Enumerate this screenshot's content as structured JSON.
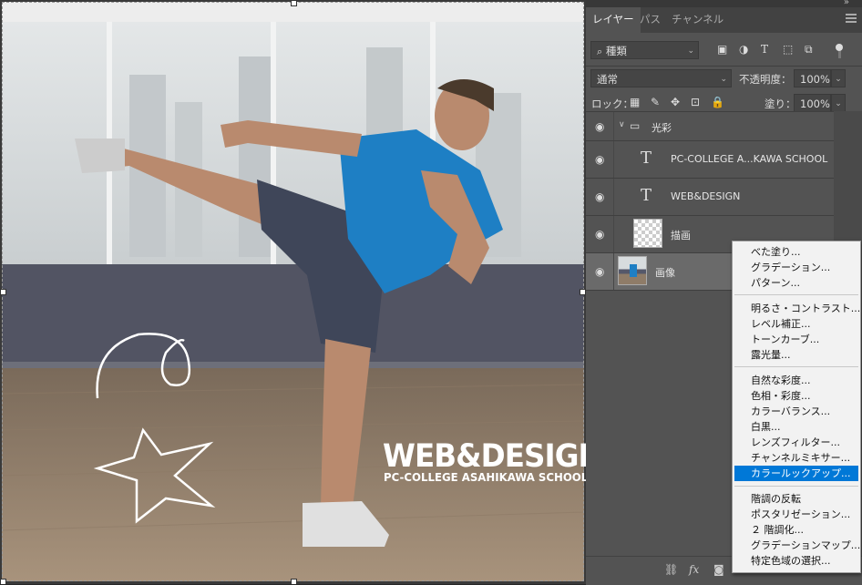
{
  "canvas": {
    "title_text": "WEB&DESIGN",
    "subtitle_text": "PC-COLLEGE ASAHIKAWA SCHOOL"
  },
  "panel": {
    "tabs": [
      {
        "label": "レイヤー",
        "active": true
      },
      {
        "label": "パス",
        "active": false
      },
      {
        "label": "チャンネル",
        "active": false
      }
    ],
    "filter_kind": "種類",
    "blend_mode": "通常",
    "opacity_label": "不透明度：",
    "opacity_value": "100%",
    "lock_label": "ロック：",
    "fill_label": "塗り：",
    "fill_value": "100%",
    "layers": [
      {
        "name": "光彩",
        "type": "group"
      },
      {
        "name": "PC-COLLEGE A...KAWA SCHOOL",
        "type": "text"
      },
      {
        "name": "WEB&DESIGN",
        "type": "text"
      },
      {
        "name": "描画",
        "type": "raster"
      },
      {
        "name": "画像",
        "type": "image",
        "selected": true
      }
    ]
  },
  "context_menu": {
    "groups": [
      [
        "べた塗り...",
        "グラデーション...",
        "パターン..."
      ],
      [
        "明るさ・コントラスト...",
        "レベル補正...",
        "トーンカーブ...",
        "露光量..."
      ],
      [
        "自然な彩度...",
        "色相・彩度...",
        "カラーバランス...",
        "白黒...",
        "レンズフィルター...",
        "チャンネルミキサー...",
        "カラールックアップ..."
      ],
      [
        "階調の反転",
        "ポスタリゼーション...",
        "２ 階調化...",
        "グラデーションマップ...",
        "特定色域の選択..."
      ]
    ],
    "highlighted": "カラールックアップ..."
  },
  "colors": {
    "panel_bg": "#535353",
    "selected_layer": "#6a6a6a",
    "menu_highlight": "#0078d7"
  }
}
